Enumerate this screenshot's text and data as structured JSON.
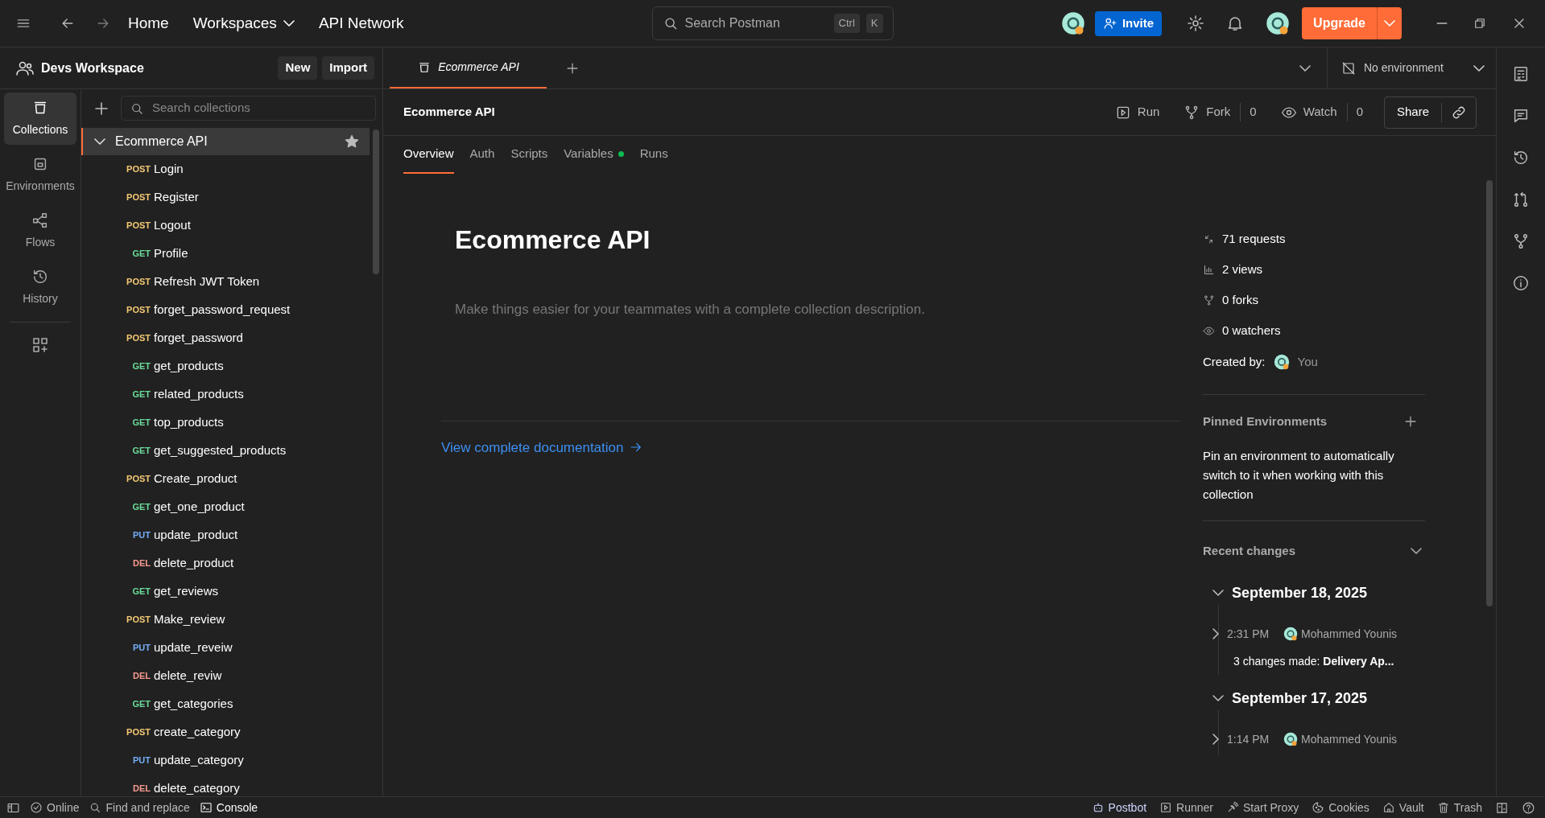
{
  "top_bar": {
    "nav_links": [
      {
        "label": "Home",
        "dropdown": false
      },
      {
        "label": "Workspaces",
        "dropdown": true
      },
      {
        "label": "API Network",
        "dropdown": false
      }
    ],
    "search": {
      "placeholder": "Search Postman",
      "shortcut": [
        "Ctrl",
        "K"
      ]
    },
    "invite": "Invite",
    "upgrade": "Upgrade"
  },
  "workspace": {
    "name": "Devs Workspace",
    "buttons": [
      "New",
      "Import"
    ]
  },
  "nav_rail": [
    {
      "kind": "collections",
      "label": "Collections",
      "selected": true
    },
    {
      "kind": "environments",
      "label": "Environments",
      "selected": false
    },
    {
      "kind": "flows",
      "label": "Flows",
      "selected": false
    },
    {
      "kind": "history",
      "label": "History",
      "selected": false
    }
  ],
  "collections": {
    "search_placeholder": "Search collections",
    "collection": {
      "name": "Ecommerce API",
      "expanded": true,
      "selected": true,
      "starred": true,
      "requests": [
        {
          "kind": "post",
          "method": "POST",
          "name": "Login"
        },
        {
          "kind": "post",
          "method": "POST",
          "name": "Register"
        },
        {
          "kind": "post",
          "method": "POST",
          "name": "Logout"
        },
        {
          "kind": "get",
          "method": "GET",
          "name": "Profile"
        },
        {
          "kind": "post",
          "method": "POST",
          "name": "Refresh JWT Token"
        },
        {
          "kind": "post",
          "method": "POST",
          "name": "forget_password_request"
        },
        {
          "kind": "post",
          "method": "POST",
          "name": "forget_password"
        },
        {
          "kind": "get",
          "method": "GET",
          "name": "get_products"
        },
        {
          "kind": "get",
          "method": "GET",
          "name": "related_products"
        },
        {
          "kind": "get",
          "method": "GET",
          "name": "top_products"
        },
        {
          "kind": "get",
          "method": "GET",
          "name": "get_suggested_products"
        },
        {
          "kind": "post",
          "method": "POST",
          "name": "Create_product"
        },
        {
          "kind": "get",
          "method": "GET",
          "name": "get_one_product"
        },
        {
          "kind": "put",
          "method": "PUT",
          "name": "update_product"
        },
        {
          "kind": "delete",
          "method": "DEL",
          "name": "delete_product"
        },
        {
          "kind": "get",
          "method": "GET",
          "name": "get_reviews"
        },
        {
          "kind": "post",
          "method": "POST",
          "name": "Make_review"
        },
        {
          "kind": "put",
          "method": "PUT",
          "name": "update_reveiw"
        },
        {
          "kind": "delete",
          "method": "DEL",
          "name": "delete_reviw"
        },
        {
          "kind": "get",
          "method": "GET",
          "name": "get_categories"
        },
        {
          "kind": "post",
          "method": "POST",
          "name": "create_category"
        },
        {
          "kind": "put",
          "method": "PUT",
          "name": "update_category"
        },
        {
          "kind": "delete",
          "method": "DEL",
          "name": "delete_category"
        }
      ]
    }
  },
  "open_tabs": [
    {
      "label": "Ecommerce API",
      "selected": true
    }
  ],
  "environment": "No environment",
  "collection_header": {
    "title": "Ecommerce API",
    "actions": [
      {
        "kind": "run",
        "label": "Run"
      },
      {
        "kind": "fork",
        "label": "Fork",
        "count": "0"
      },
      {
        "kind": "watch",
        "label": "Watch",
        "count": "0"
      }
    ],
    "share": "Share"
  },
  "sub_tabs": [
    {
      "label": "Overview",
      "selected": true,
      "indicator": false
    },
    {
      "label": "Auth",
      "selected": false,
      "indicator": false
    },
    {
      "label": "Scripts",
      "selected": false,
      "indicator": false
    },
    {
      "label": "Variables",
      "selected": false,
      "indicator": true
    },
    {
      "label": "Runs",
      "selected": false,
      "indicator": false
    }
  ],
  "overview": {
    "title": "Ecommerce API",
    "description_placeholder": "Make things easier for your teammates with a complete collection description.",
    "docs_link": "View complete documentation"
  },
  "stats": [
    {
      "kind": "requests",
      "text": "71 requests"
    },
    {
      "kind": "views",
      "text": "2 views"
    },
    {
      "kind": "forks",
      "text": "0 forks"
    },
    {
      "kind": "watchers",
      "text": "0 watchers"
    }
  ],
  "created_by": {
    "label": "Created by:",
    "user": "You"
  },
  "pinned_environments": {
    "title": "Pinned Environments",
    "text": "Pin an environment to automatically switch to it when working with this collection"
  },
  "recent_changes": {
    "title": "Recent changes",
    "expanded": true,
    "days": [
      {
        "date": "September 18, 2025",
        "expanded": true,
        "entries": [
          {
            "time": "2:31 PM",
            "user": "Mohammed Younis",
            "expanded": false,
            "summary": "3 changes made: **Delivery Ap...**"
          }
        ]
      },
      {
        "date": "September 17, 2025",
        "expanded": true,
        "entries": [
          {
            "time": "1:14 PM",
            "user": "Mohammed Younis",
            "expanded": false
          }
        ]
      }
    ]
  },
  "status_bar": {
    "left": [
      {
        "kind": "online",
        "label": "Online"
      },
      {
        "kind": "find",
        "label": "Find and replace"
      },
      {
        "kind": "console",
        "label": "Console"
      }
    ],
    "right": [
      {
        "kind": "postbot",
        "label": "Postbot"
      },
      {
        "kind": "runner",
        "label": "Runner"
      },
      {
        "kind": "proxy",
        "label": "Start Proxy"
      },
      {
        "kind": "cookies",
        "label": "Cookies"
      },
      {
        "kind": "vault",
        "label": "Vault"
      },
      {
        "kind": "trash",
        "label": "Trash"
      }
    ]
  }
}
